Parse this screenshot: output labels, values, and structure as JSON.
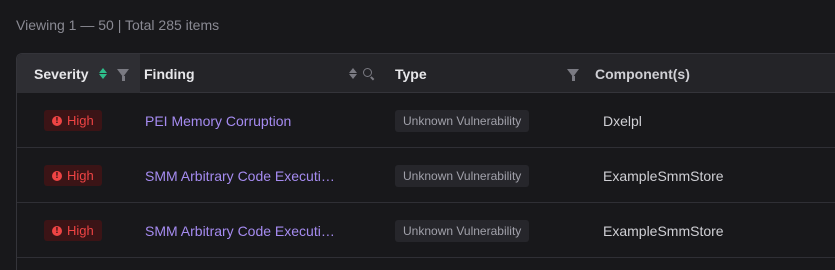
{
  "summary": "Viewing 1 — 50 | Total 285 items",
  "columns": {
    "severity": "Severity",
    "finding": "Finding",
    "type": "Type",
    "components": "Component(s)"
  },
  "rows": [
    {
      "severity": "High",
      "finding": "PEI Memory Corruption",
      "type": "Unknown Vulnerability",
      "component": "Dxelpl"
    },
    {
      "severity": "High",
      "finding": "SMM Arbitrary Code Executi…",
      "type": "Unknown Vulnerability",
      "component": "ExampleSmmStore"
    },
    {
      "severity": "High",
      "finding": "SMM Arbitrary Code Executi…",
      "type": "Unknown Vulnerability",
      "component": "ExampleSmmStore"
    }
  ],
  "colors": {
    "severity_high": "#ef4444",
    "finding_link": "#a58bf0",
    "sort_active": "#2ebd8a"
  },
  "icons": [
    "sort-active-icon",
    "filter-icon",
    "sort-icon",
    "search-icon",
    "alert-icon"
  ]
}
